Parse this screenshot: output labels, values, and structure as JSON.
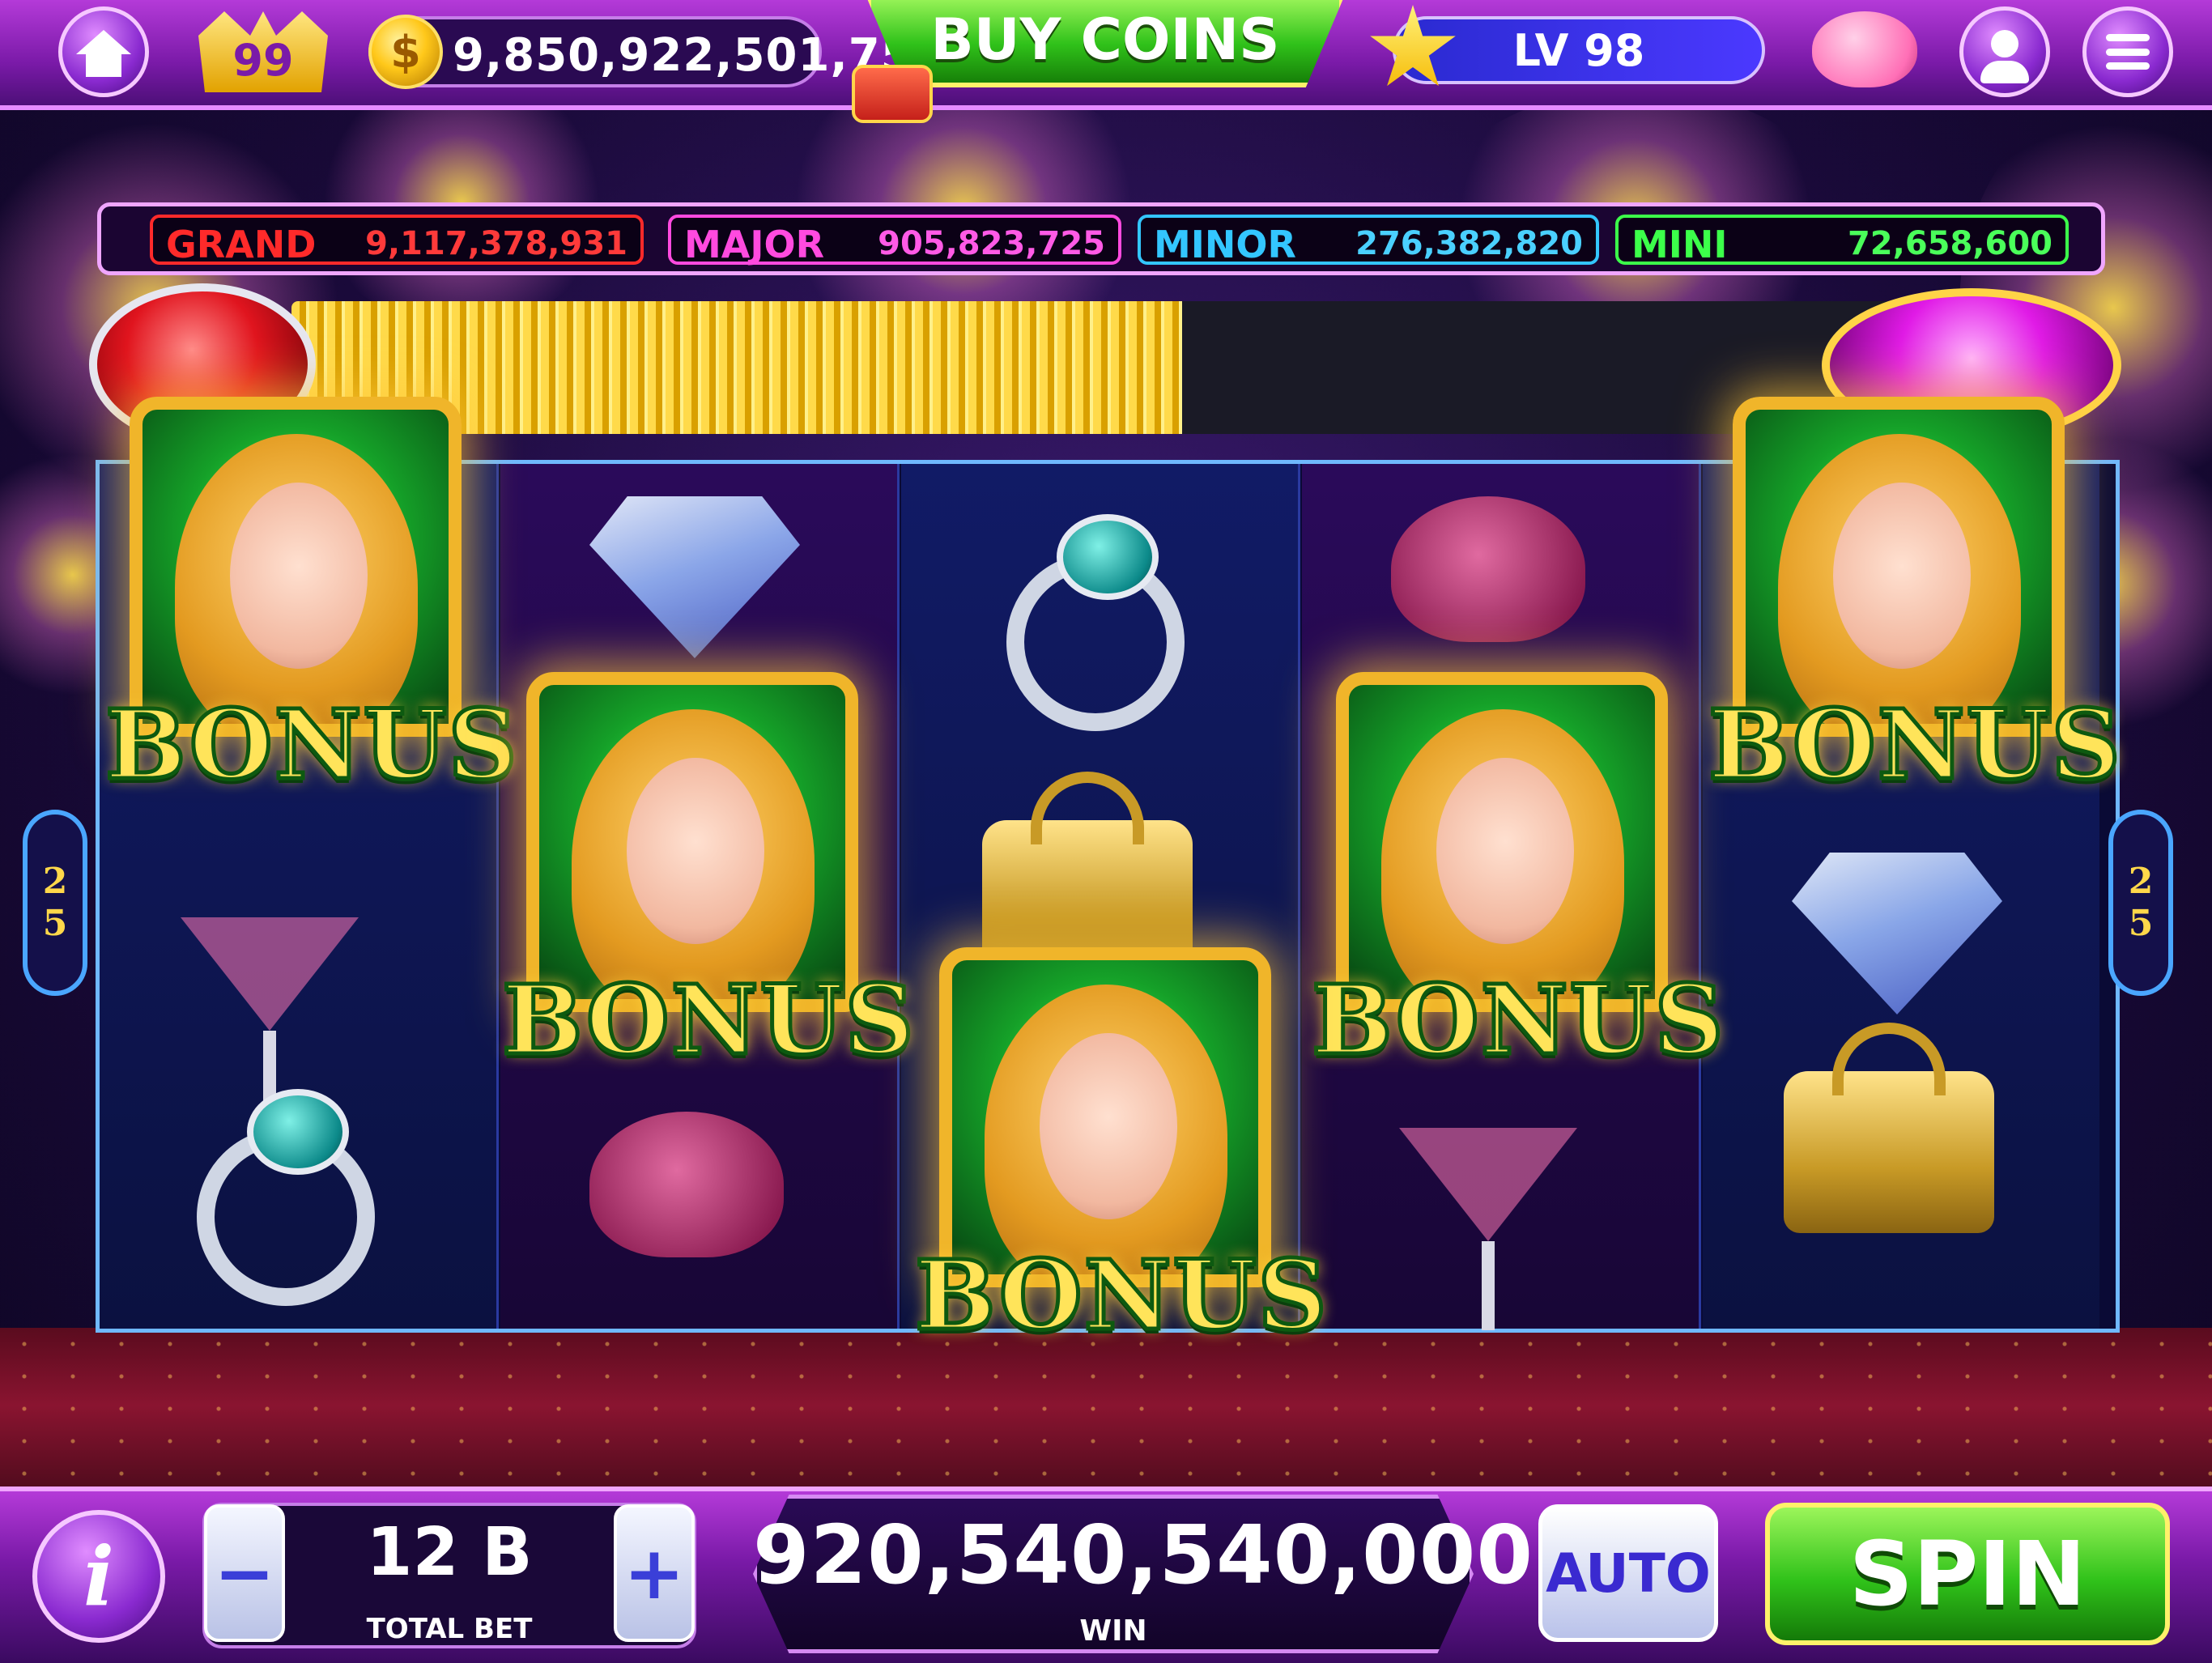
{
  "header": {
    "level_badge": "99",
    "coins": "9,850,922,501,751",
    "buy_coins_label": "BUY COINS",
    "player_level": "LV 98"
  },
  "jackpots": [
    {
      "label": "GRAND",
      "value": "9,117,378,931",
      "color": "#ff2a2a"
    },
    {
      "label": "MAJOR",
      "value": "905,823,725",
      "color": "#ff4adf"
    },
    {
      "label": "MINOR",
      "value": "276,382,820",
      "color": "#33c6ff"
    },
    {
      "label": "MINI",
      "value": "72,658,600",
      "color": "#3cff4a"
    }
  ],
  "jackpot_progress": 0.55,
  "reels": {
    "lines_left": [
      "2",
      "5"
    ],
    "lines_right": [
      "2",
      "5"
    ],
    "bonus_label": "BONUS"
  },
  "footer": {
    "bet_minus": "−",
    "bet_plus": "+",
    "total_bet_value": "12 B",
    "total_bet_label": "TOTAL BET",
    "win_value": "920,540,540,000",
    "win_label": "WIN",
    "auto_label": "AUTO",
    "spin_label": "SPIN",
    "info_label": "i"
  },
  "colors": {
    "accent_purple": "#8a2ad0",
    "buy_green": "#30c21a",
    "bonus_gold": "#ffe45a"
  }
}
